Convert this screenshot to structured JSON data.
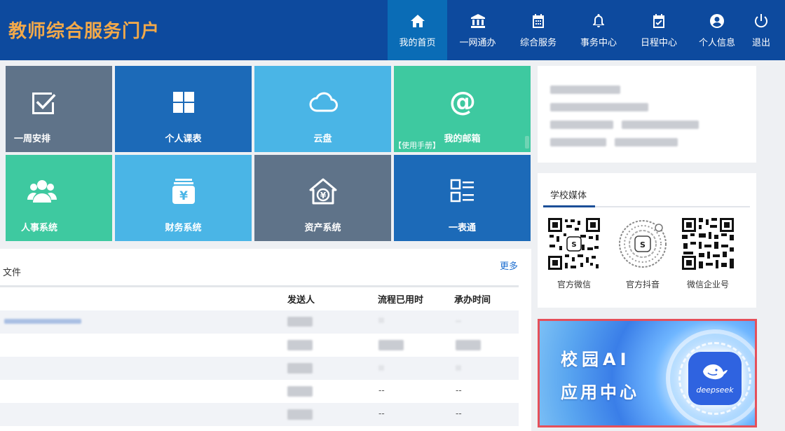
{
  "header": {
    "brand": "教师综合服务门户",
    "nav": [
      {
        "label": "我的首页",
        "icon": "home-icon",
        "active": true
      },
      {
        "label": "一网通办",
        "icon": "bank-icon"
      },
      {
        "label": "综合服务",
        "icon": "calendar-grid-icon"
      },
      {
        "label": "事务中心",
        "icon": "bell-icon"
      },
      {
        "label": "日程中心",
        "icon": "calendar-check-icon"
      },
      {
        "label": "个人信息",
        "icon": "user-circle-icon"
      },
      {
        "label": "退出",
        "icon": "power-icon"
      }
    ]
  },
  "tiles": [
    {
      "label": "一周安排",
      "icon": "checkbox-icon",
      "color": "#5f7389"
    },
    {
      "label": "个人课表",
      "icon": "grid-icon",
      "color": "#1c6ab8"
    },
    {
      "label": "云盘",
      "icon": "cloud-icon",
      "color": "#4ab5e6"
    },
    {
      "label": "我的邮箱",
      "icon": "at-icon",
      "color": "#3ec9a0",
      "note": "【使用手册】"
    },
    {
      "label": "人事系统",
      "icon": "people-icon",
      "color": "#3ec9a0"
    },
    {
      "label": "财务系统",
      "icon": "money-stack-icon",
      "color": "#4ab5e6"
    },
    {
      "label": "资产系统",
      "icon": "house-yen-icon",
      "color": "#5f7389"
    },
    {
      "label": "一表通",
      "icon": "list-form-icon",
      "color": "#1c6ab8"
    }
  ],
  "files": {
    "title": "文件",
    "more": "更多",
    "columns": [
      "发送人",
      "流程已用时",
      "承办时间"
    ],
    "dash": "--"
  },
  "media": {
    "title": "学校媒体",
    "items": [
      {
        "label": "官方微信",
        "icon": "wechat-qr-icon"
      },
      {
        "label": "官方抖音",
        "icon": "douyin-qr-icon"
      },
      {
        "label": "微信企业号",
        "icon": "wecom-qr-icon"
      }
    ]
  },
  "ai_banner": {
    "line1": "校园AI",
    "line2": "应用中心",
    "logo_text": "deepseek",
    "icon": "deepseek-logo-icon"
  },
  "colors": {
    "header_bg": "#0d4a9e",
    "brand": "#f2a94a",
    "nav_active": "#0a6cb6",
    "link": "#1e6fd0",
    "highlight_border": "#e5505a"
  }
}
